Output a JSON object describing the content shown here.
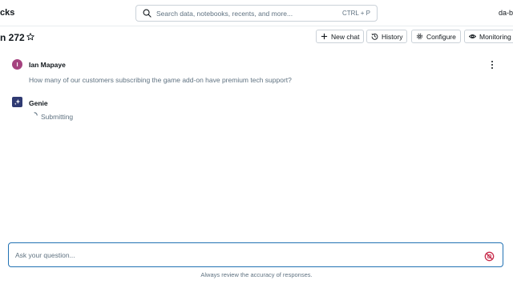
{
  "header": {
    "brand": "cks",
    "search": {
      "placeholder": "Search data, notebooks, recents, and more...",
      "shortcut": "CTRL + P",
      "icon": "search-icon"
    },
    "workspace": "da-b"
  },
  "space": {
    "title": "n 272",
    "buttons": {
      "new_chat": "New chat",
      "history": "History",
      "configure": "Configure",
      "monitoring": "Monitoring"
    }
  },
  "conversation": {
    "user": {
      "initial": "I",
      "name": "Ian Mapaye",
      "avatar_color": "#a5427f",
      "question": "How many of our customers subscribing the game add-on have premium tech support?"
    },
    "assistant": {
      "name": "Genie",
      "avatar_color": "#2f3a72",
      "status": "Submitting"
    }
  },
  "composer": {
    "placeholder": "Ask your question...",
    "stop_color": "#c82d4c",
    "disclaimer": "Always review the accuracy of responses."
  },
  "colors": {
    "accent": "#2272b4",
    "muted_text": "#5f7281"
  }
}
